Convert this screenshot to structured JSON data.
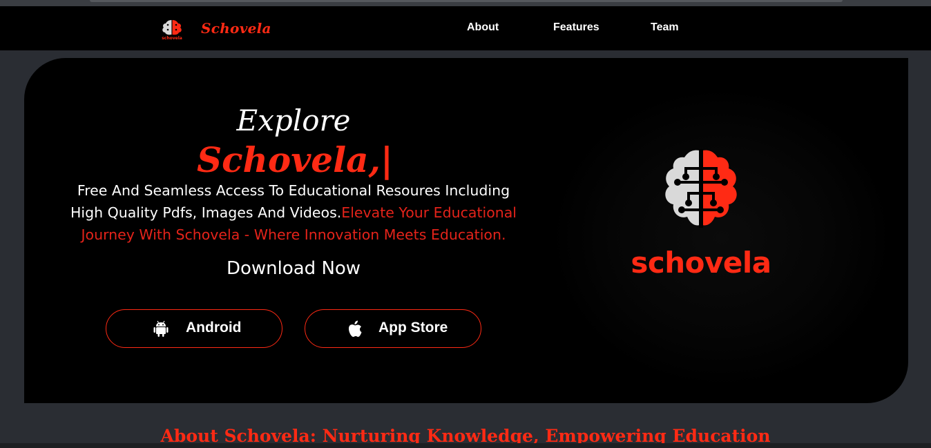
{
  "nav": {
    "brand_name": "Schovela",
    "logo_caption": "schovela",
    "links": [
      "About",
      "Features",
      "Team"
    ]
  },
  "hero": {
    "title_line1": "Explore",
    "title_brand": "Schovela,|",
    "description_white": "Free And Seamless Access To Educational Resoures Including High Quality Pdfs, Images And Videos.",
    "description_red": "Elevate Your Educational Journey With Schovela - Where Innovation Meets Education.",
    "download_label": "Download Now",
    "buttons": [
      {
        "label": "Android",
        "icon": "android-icon"
      },
      {
        "label": "App Store",
        "icon": "apple-icon"
      }
    ],
    "logo_text": "schovela"
  },
  "about": {
    "heading": "About Schovela: Nurturing Knowledge, Empowering Education"
  },
  "colors": {
    "accent": "#ff2a14",
    "background": "#2a2d33",
    "panel": "#000000",
    "brain_light": "#d9d9d9"
  }
}
